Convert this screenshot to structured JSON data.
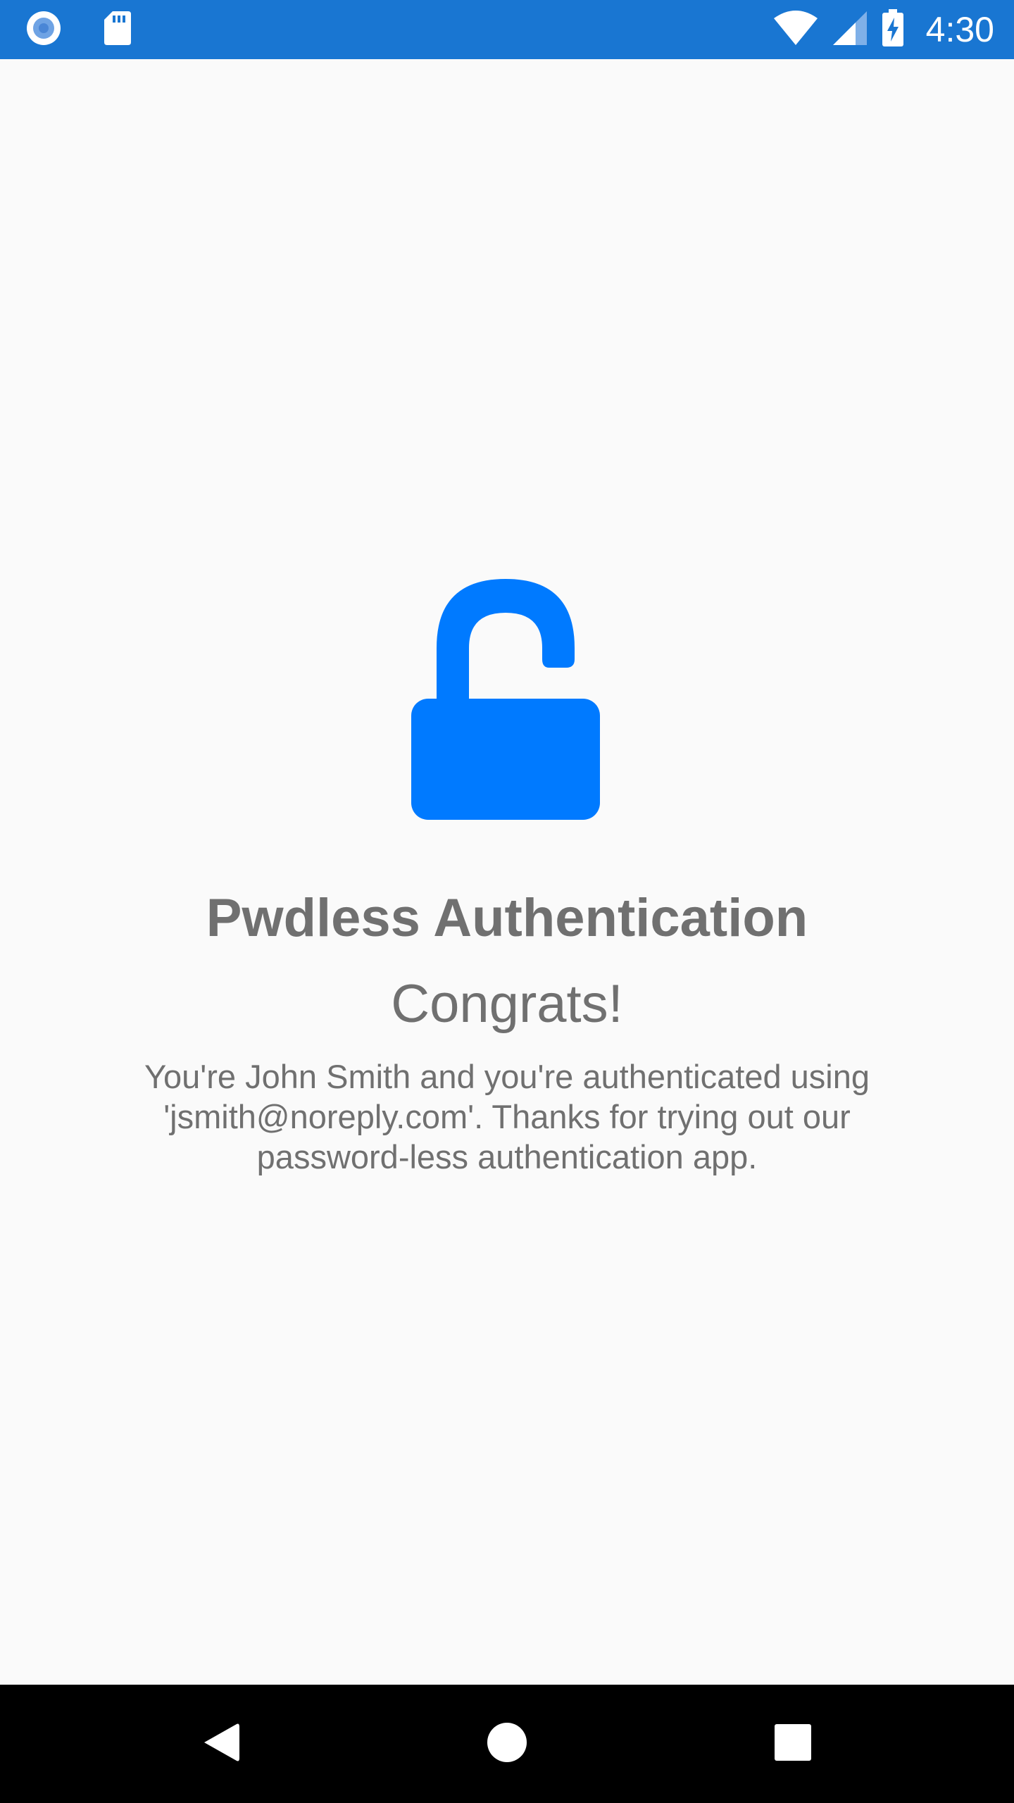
{
  "status_bar": {
    "time": "4:30",
    "background_color": "#1976d2",
    "left_icons": [
      "sync-circle-icon",
      "sd-card-icon"
    ],
    "right_icons": [
      "wifi-icon",
      "cellular-signal-icon",
      "battery-charging-icon"
    ]
  },
  "main": {
    "icon": "unlocked-padlock-icon",
    "icon_color": "#007aff",
    "title": "Pwdless Authentication",
    "subtitle": "Congrats!",
    "message": "You're John Smith and you're authenticated using\n'jsmith@noreply.com'.  Thanks for trying out our\npassword-less authentication app."
  },
  "nav_bar": {
    "buttons": [
      "back-icon",
      "home-icon",
      "recents-icon"
    ]
  }
}
